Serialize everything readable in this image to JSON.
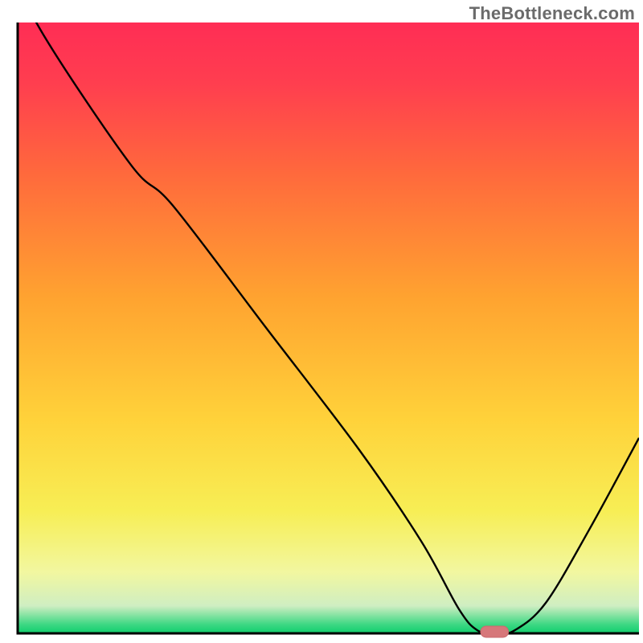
{
  "watermark": "TheBottleneck.com",
  "colors": {
    "axis": "#000000",
    "curve": "#000000",
    "marker_fill": "#d6777a",
    "marker_stroke": "#c96a6d",
    "gradient_stops": [
      {
        "offset": 0.0,
        "color": "#ff2d55"
      },
      {
        "offset": 0.1,
        "color": "#ff3e4f"
      },
      {
        "offset": 0.25,
        "color": "#ff6a3c"
      },
      {
        "offset": 0.45,
        "color": "#ffa330"
      },
      {
        "offset": 0.65,
        "color": "#ffd23a"
      },
      {
        "offset": 0.8,
        "color": "#f7ee55"
      },
      {
        "offset": 0.9,
        "color": "#f2f7a0"
      },
      {
        "offset": 0.955,
        "color": "#cfeec2"
      },
      {
        "offset": 0.985,
        "color": "#3fd884"
      },
      {
        "offset": 1.0,
        "color": "#0fce6c"
      }
    ]
  },
  "chart_data": {
    "type": "line",
    "title": "",
    "xlabel": "",
    "ylabel": "",
    "xlim": [
      0,
      100
    ],
    "ylim": [
      0,
      100
    ],
    "x": [
      0,
      3,
      18,
      25,
      40,
      55,
      65,
      71,
      74,
      77,
      80,
      85,
      92,
      100
    ],
    "values": [
      110,
      100,
      77,
      70,
      50,
      30,
      15,
      4,
      0.5,
      0,
      0.5,
      5,
      17,
      32
    ],
    "marker": {
      "x_start": 74.5,
      "x_end": 79,
      "y": 0
    }
  }
}
